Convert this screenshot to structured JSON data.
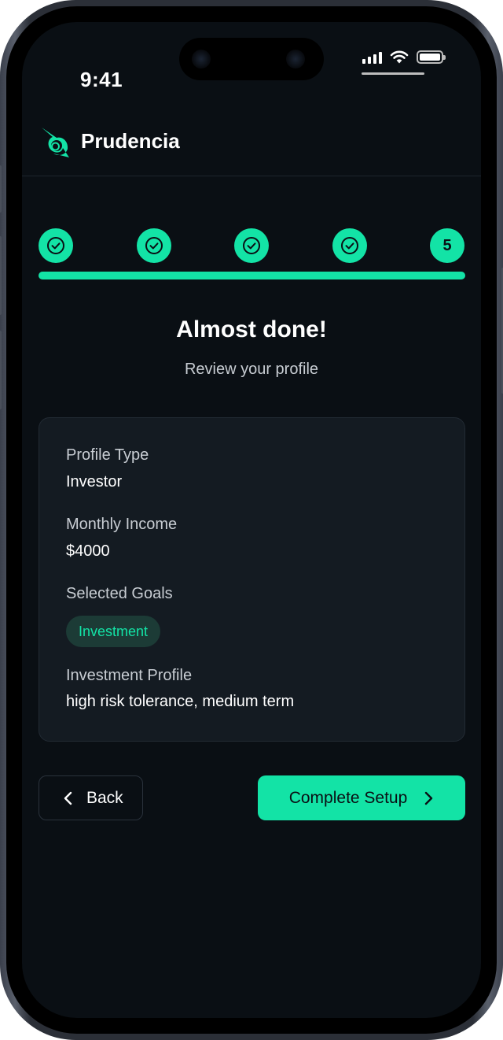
{
  "status_bar": {
    "time": "9:41"
  },
  "app": {
    "brand_name": "Prudencia",
    "accent_color": "#13e3a6",
    "background_color": "#0a0f14"
  },
  "stepper": {
    "total_steps": 5,
    "current_step": 5,
    "steps": [
      {
        "state": "completed",
        "icon": "check-circle-icon"
      },
      {
        "state": "completed",
        "icon": "check-circle-icon"
      },
      {
        "state": "completed",
        "icon": "check-circle-icon"
      },
      {
        "state": "completed",
        "icon": "check-circle-icon"
      },
      {
        "state": "current",
        "label": "5"
      }
    ],
    "progress": 1.0
  },
  "page": {
    "title": "Almost done!",
    "subtitle": "Review your profile"
  },
  "review": {
    "profile_type_label": "Profile Type",
    "profile_type_value": "Investor",
    "income_label": "Monthly Income",
    "income_value": "$4000",
    "goals_label": "Selected Goals",
    "goals": [
      "Investment"
    ],
    "investment_profile_label": "Investment Profile",
    "investment_profile_value": "high risk tolerance, medium term"
  },
  "actions": {
    "back_label": "Back",
    "complete_label": "Complete Setup"
  }
}
